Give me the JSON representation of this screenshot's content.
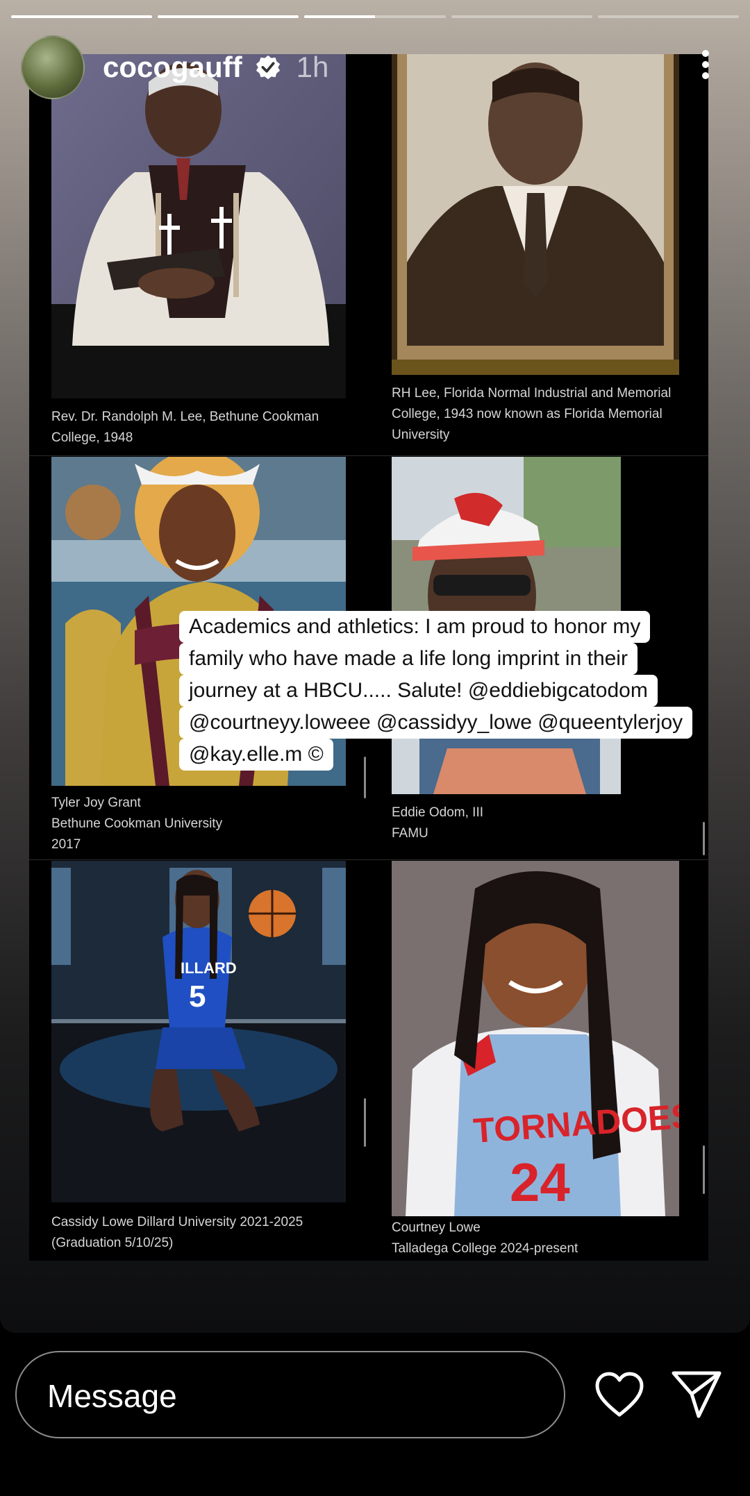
{
  "header": {
    "username": "cocogauff",
    "time": "1h"
  },
  "progress": {
    "segments": 5,
    "active_index": 2,
    "active_fraction": 0.5
  },
  "captions": {
    "c1": "Rev. Dr. Randolph M. Lee, Bethune Cookman\nCollege, 1948",
    "c2": "RH Lee, Florida Normal Industrial and Memorial\nCollege, 1943 now known as Florida Memorial\nUniversity",
    "c3": "Tyler Joy Grant\nBethune Cookman University\n2017",
    "c4": "Eddie Odom, III\nFAMU",
    "c5": "Cassidy Lowe Dillard University 2021-2025\n(Graduation 5/10/25)",
    "c6": "Courtney Lowe\nTalladega College 2024-present"
  },
  "jersey_text": {
    "dillard": "ILLARD",
    "dillard_num": "5",
    "tornadoes": "TORNADOES",
    "tornadoes_num": "24"
  },
  "sticker": {
    "line1": "Academics and athletics: I am proud to honor my",
    "line2": "family who have made a life long imprint in their",
    "line3": "journey at a HBCU..... Salute! @eddiebigcatodom",
    "line4": "@courtneyy.loweee @cassidyy_lowe @queentylerjoy",
    "line5": "@kay.elle.m ©"
  },
  "reply": {
    "placeholder": "Message"
  },
  "icons": {
    "verified": "verified-badge-icon",
    "more": "more-options-icon",
    "like": "heart-icon",
    "share": "send-icon"
  },
  "colors": {
    "story_bg": "#0d0e10",
    "text": "#ffffff",
    "caption": "#d6d6d6"
  }
}
